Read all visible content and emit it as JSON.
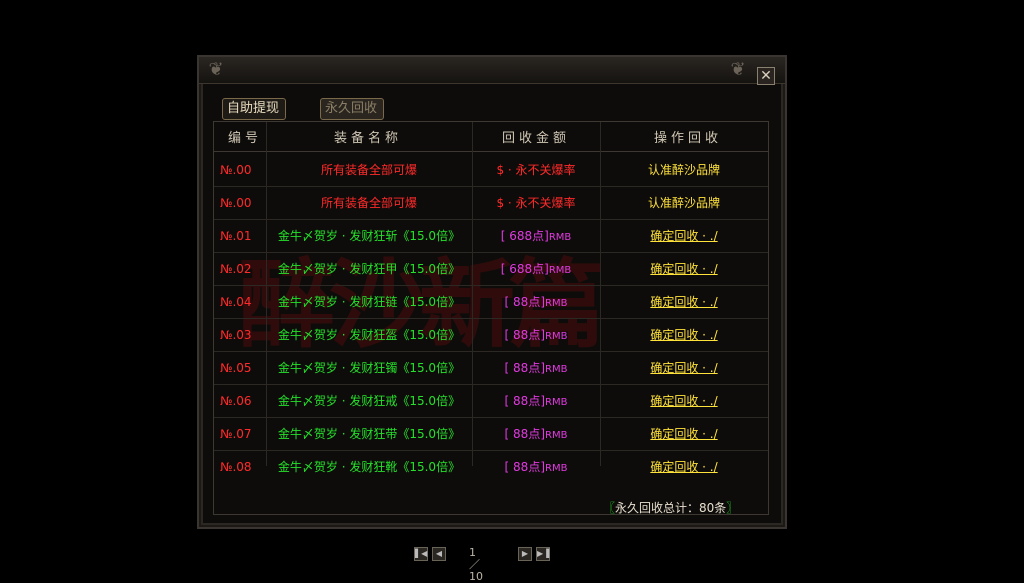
{
  "window": {
    "close_symbol": "✕"
  },
  "watermark_text": "醉沙新篇",
  "tabs": [
    {
      "label": "自助提现"
    },
    {
      "label": "永久回收"
    }
  ],
  "table": {
    "headers": [
      "编号",
      "装备名称",
      "回收金额",
      "操作回收"
    ],
    "rows": [
      {
        "id": "№.00",
        "name": "所有装备全部可爆",
        "price": "$ · 永不关爆率",
        "unit": "",
        "action": "认准醉沙品牌",
        "style": "header"
      },
      {
        "id": "№.00",
        "name": "所有装备全部可爆",
        "price": "$ · 永不关爆率",
        "unit": "",
        "action": "认准醉沙品牌",
        "style": "header"
      },
      {
        "id": "№.01",
        "name": "金牛〆贺岁 · 发财狂斩《15.0倍》",
        "price": "[ 688点]",
        "unit": "RMB",
        "action": "确定回收 · ./",
        "style": "item"
      },
      {
        "id": "№.02",
        "name": "金牛〆贺岁 · 发财狂甲《15.0倍》",
        "price": "[ 688点]",
        "unit": "RMB",
        "action": "确定回收 · ./",
        "style": "item"
      },
      {
        "id": "№.04",
        "name": "金牛〆贺岁 · 发财狂链《15.0倍》",
        "price": "[  88点]",
        "unit": "RMB",
        "action": "确定回收 · ./",
        "style": "item"
      },
      {
        "id": "№.03",
        "name": "金牛〆贺岁 · 发财狂盔《15.0倍》",
        "price": "[  88点]",
        "unit": "RMB",
        "action": "确定回收 · ./",
        "style": "item"
      },
      {
        "id": "№.05",
        "name": "金牛〆贺岁 · 发财狂镯《15.0倍》",
        "price": "[  88点]",
        "unit": "RMB",
        "action": "确定回收 · ./",
        "style": "item"
      },
      {
        "id": "№.06",
        "name": "金牛〆贺岁 · 发财狂戒《15.0倍》",
        "price": "[  88点]",
        "unit": "RMB",
        "action": "确定回收 · ./",
        "style": "item"
      },
      {
        "id": "№.07",
        "name": "金牛〆贺岁 · 发财狂带《15.0倍》",
        "price": "[  88点]",
        "unit": "RMB",
        "action": "确定回收 · ./",
        "style": "item"
      },
      {
        "id": "№.08",
        "name": "金牛〆贺岁 · 发财狂靴《15.0倍》",
        "price": "[  88点]",
        "unit": "RMB",
        "action": "确定回收 · ./",
        "style": "item"
      }
    ]
  },
  "pager": {
    "first_icon": "first-page-icon",
    "prev_icon": "prev-page-icon",
    "next_icon": "next-page-icon",
    "last_icon": "last-page-icon",
    "page_text": "1／10"
  },
  "total": {
    "left_bracket": "〖",
    "label": "永久回收总计：80条",
    "right_bracket": "〗"
  },
  "colors": {
    "red": "#ff2a2a",
    "green": "#25e02a",
    "yellow": "#ffe23a",
    "magenta": "#e03ae0"
  }
}
